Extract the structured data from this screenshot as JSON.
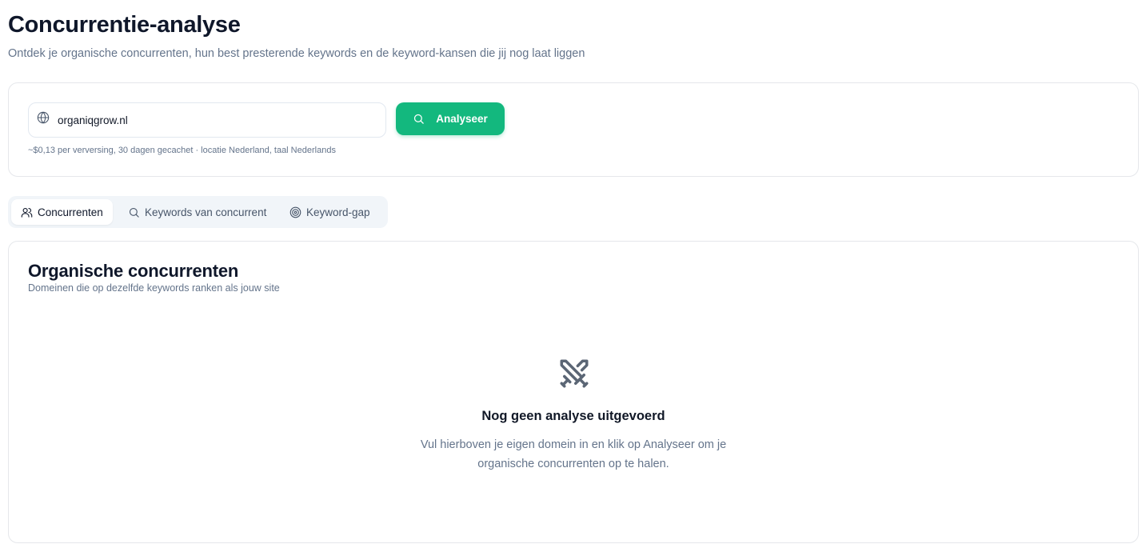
{
  "header": {
    "title": "Concurrentie-analyse",
    "subtitle": "Ontdek je organische concurrenten, hun best presterende keywords en de keyword-kansen die jij nog laat liggen"
  },
  "search": {
    "domain_value": "organiqgrow.nl",
    "button_label": "Analyseer",
    "note": "~$0,13 per verversing, 30 dagen gecachet · locatie Nederland, taal Nederlands"
  },
  "tabs": [
    {
      "label": "Concurrenten",
      "icon": "users-icon",
      "active": true
    },
    {
      "label": "Keywords van concurrent",
      "icon": "search-icon",
      "active": false
    },
    {
      "label": "Keyword-gap",
      "icon": "target-icon",
      "active": false
    }
  ],
  "results": {
    "title": "Organische concurrenten",
    "subtitle": "Domeinen die op dezelfde keywords ranken als jouw site",
    "empty_icon": "swords-icon",
    "empty_title": "Nog geen analyse uitgevoerd",
    "empty_text": "Vul hierboven je eigen domein in en klik op Analyseer om je organische concurrenten op te halen."
  },
  "colors": {
    "accent": "#13b87e",
    "muted_text": "#64748b",
    "border": "#e5e7eb",
    "tab_background": "#f1f5f9"
  }
}
